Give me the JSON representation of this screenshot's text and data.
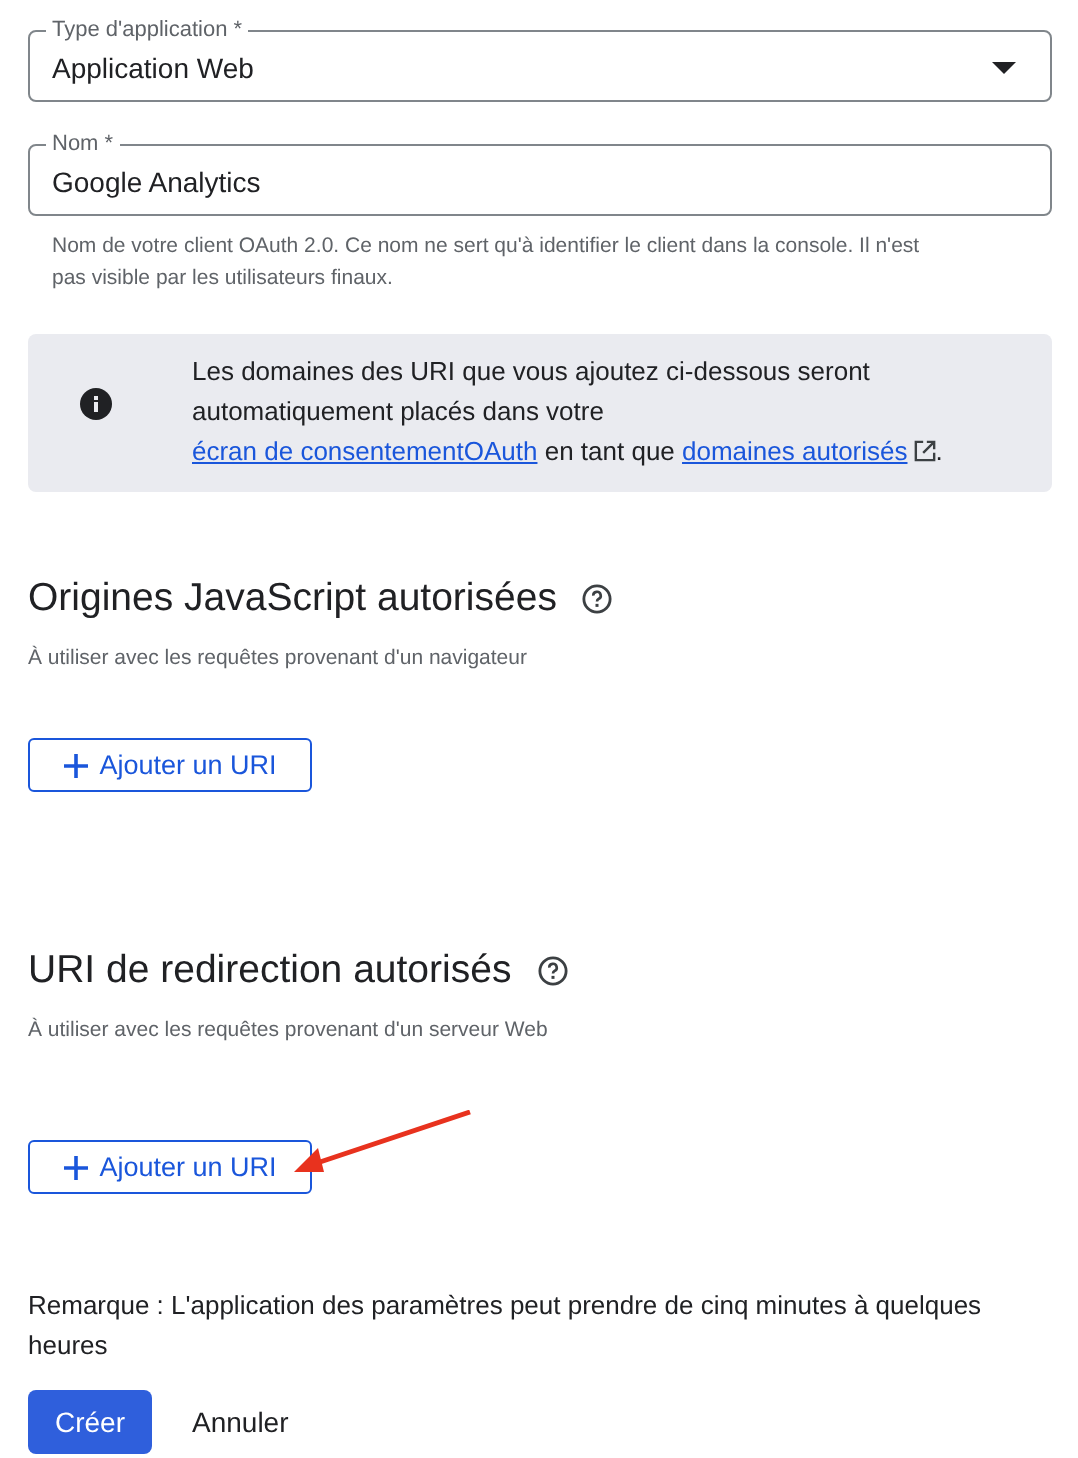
{
  "fields": [
    {
      "kind": "select",
      "label": "Type d'application *",
      "value": "Application Web"
    },
    {
      "kind": "text",
      "label": "Nom *",
      "value": "Google Analytics",
      "helper": "Nom de votre client OAuth 2.0. Ce nom ne sert qu'à identifier le client dans la console. Il n'est pas visible par les utilisateurs finaux."
    }
  ],
  "info": {
    "segments": [
      {
        "kind": "text",
        "text": "Les domaines des URI que vous ajoutez ci-dessous seront automatiquement placés dans votre "
      },
      {
        "kind": "link",
        "text": "écran de consentementOAuth",
        "external": false
      },
      {
        "kind": "text",
        "text": " en tant que "
      },
      {
        "kind": "link",
        "text": "domaines autorisés",
        "external": true
      },
      {
        "kind": "text",
        "text": "."
      }
    ]
  },
  "sections": [
    {
      "title": "Origines JavaScript autorisées",
      "subtitle": "À utiliser avec les requêtes provenant d'un navigateur",
      "button": "Ajouter un URI",
      "annotated": false
    },
    {
      "title": "URI de redirection autorisés",
      "subtitle": "À utiliser avec les requêtes provenant d'un serveur Web",
      "button": "Ajouter un URI",
      "annotated": true
    }
  ],
  "note": "Remarque : L'application des paramètres peut prendre de cinq minutes à quelques heures",
  "actions": [
    {
      "label": "Créer",
      "kind": "primary"
    },
    {
      "label": "Annuler",
      "kind": "text"
    }
  ]
}
